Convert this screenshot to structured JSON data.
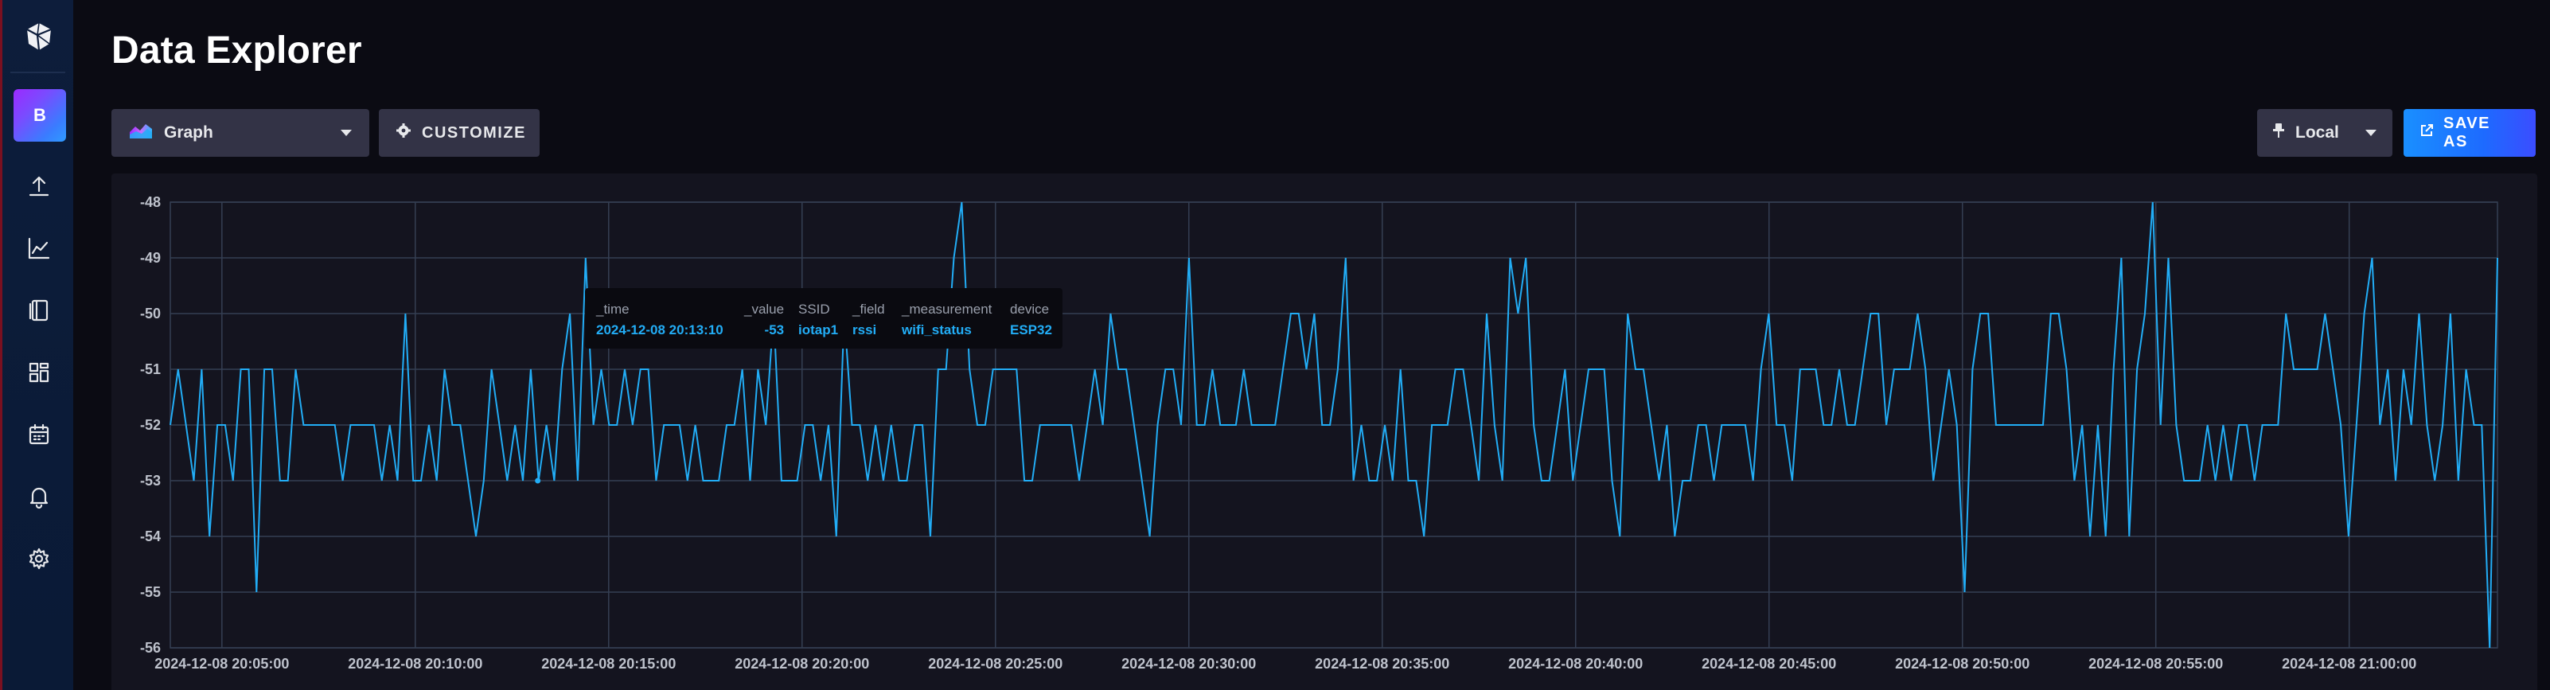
{
  "nav": {
    "logo_icon": "influxdb-cube-icon",
    "org_initial": "B",
    "items": [
      {
        "name": "upload-icon"
      },
      {
        "name": "data-explorer-graph-icon"
      },
      {
        "name": "notebooks-icon"
      },
      {
        "name": "dashboards-icon"
      },
      {
        "name": "tasks-calendar-icon"
      },
      {
        "name": "alerts-bell-icon"
      },
      {
        "name": "settings-gear-icon"
      }
    ]
  },
  "header": {
    "title": "Data Explorer"
  },
  "toolbar": {
    "viz_type_label": "Graph",
    "customize_label": "CUSTOMIZE",
    "timezone_label": "Local",
    "save_as_label": "SAVE AS"
  },
  "colors": {
    "accent": "#22adf6",
    "line": "#22adf6",
    "background": "#0b0b13",
    "panel": "#14141f",
    "grid": "#353f53",
    "save_gradient": [
      "#1a8fff",
      "#3b4dff"
    ]
  },
  "tooltip": {
    "columns": [
      {
        "header": "_time",
        "value": "2024-12-08 20:13:10"
      },
      {
        "header": "_value",
        "value": "-53"
      },
      {
        "header": "SSID",
        "value": "iotap1"
      },
      {
        "header": "_field",
        "value": "rssi"
      },
      {
        "header": "_measurement",
        "value": "wifi_status"
      },
      {
        "header": "device",
        "value": "ESP32"
      }
    ]
  },
  "chart_data": {
    "type": "line",
    "title": "",
    "xlabel": "",
    "ylabel": "",
    "ylim": [
      -56,
      -48
    ],
    "y_ticks": [
      "-48",
      "-49",
      "-50",
      "-51",
      "-52",
      "-53",
      "-54",
      "-55",
      "-56"
    ],
    "x_ticks": [
      "2024-12-08 20:05:00",
      "2024-12-08 20:10:00",
      "2024-12-08 20:15:00",
      "2024-12-08 20:20:00",
      "2024-12-08 20:25:00",
      "2024-12-08 20:30:00",
      "2024-12-08 20:35:00",
      "2024-12-08 20:40:00",
      "2024-12-08 20:45:00",
      "2024-12-08 20:50:00",
      "2024-12-08 20:55:00",
      "2024-12-08 21:00:00"
    ],
    "x_start": "2024-12-08 20:03:40",
    "x_end": "2024-12-08 21:03:50",
    "grid": true,
    "legend": "none",
    "hover_point": {
      "x": "2024-12-08 20:13:10",
      "y": -53
    },
    "series": [
      {
        "values": [
          -52,
          -51,
          -52,
          -53,
          -51,
          -54,
          -52,
          -52,
          -53,
          -51,
          -51,
          -55,
          -51,
          -51,
          -53,
          -53,
          -51,
          -52,
          -52,
          -52,
          -52,
          -52,
          -53,
          -52,
          -52,
          -52,
          -52,
          -53,
          -52,
          -53,
          -50,
          -53,
          -53,
          -52,
          -53,
          -51,
          -52,
          -52,
          -53,
          -54,
          -53,
          -51,
          -52,
          -53,
          -52,
          -53,
          -51,
          -53,
          -52,
          -53,
          -51,
          -50,
          -53,
          -49,
          -52,
          -51,
          -52,
          -52,
          -51,
          -52,
          -51,
          -51,
          -53,
          -52,
          -52,
          -52,
          -53,
          -52,
          -53,
          -53,
          -53,
          -52,
          -52,
          -51,
          -53,
          -51,
          -52,
          -50,
          -53,
          -53,
          -53,
          -52,
          -52,
          -53,
          -52,
          -54,
          -50,
          -52,
          -52,
          -53,
          -52,
          -53,
          -52,
          -53,
          -53,
          -52,
          -52,
          -54,
          -51,
          -51,
          -49,
          -48,
          -51,
          -52,
          -52,
          -51,
          -51,
          -51,
          -51,
          -53,
          -53,
          -52,
          -52,
          -52,
          -52,
          -52,
          -53,
          -52,
          -51,
          -52,
          -50,
          -51,
          -51,
          -52,
          -53,
          -54,
          -52,
          -51,
          -51,
          -52,
          -49,
          -52,
          -52,
          -51,
          -52,
          -52,
          -52,
          -51,
          -52,
          -52,
          -52,
          -52,
          -51,
          -50,
          -50,
          -51,
          -50,
          -52,
          -52,
          -51,
          -49,
          -53,
          -52,
          -53,
          -53,
          -52,
          -53,
          -51,
          -53,
          -53,
          -54,
          -52,
          -52,
          -52,
          -51,
          -51,
          -52,
          -53,
          -50,
          -52,
          -53,
          -49,
          -50,
          -49,
          -52,
          -53,
          -53,
          -52,
          -51,
          -53,
          -52,
          -51,
          -51,
          -51,
          -53,
          -54,
          -50,
          -51,
          -51,
          -52,
          -53,
          -52,
          -54,
          -53,
          -53,
          -52,
          -52,
          -53,
          -52,
          -52,
          -52,
          -52,
          -53,
          -51,
          -50,
          -52,
          -52,
          -53,
          -51,
          -51,
          -51,
          -52,
          -52,
          -51,
          -52,
          -52,
          -51,
          -50,
          -50,
          -52,
          -51,
          -51,
          -51,
          -50,
          -51,
          -53,
          -52,
          -51,
          -52,
          -55,
          -51,
          -50,
          -50,
          -52,
          -52,
          -52,
          -52,
          -52,
          -52,
          -52,
          -50,
          -50,
          -51,
          -53,
          -52,
          -54,
          -52,
          -54,
          -51,
          -49,
          -54,
          -51,
          -50,
          -48,
          -52,
          -49,
          -52,
          -53,
          -53,
          -53,
          -52,
          -53,
          -52,
          -53,
          -52,
          -52,
          -53,
          -52,
          -52,
          -52,
          -50,
          -51,
          -51,
          -51,
          -51,
          -50,
          -51,
          -52,
          -54,
          -52,
          -50,
          -49,
          -52,
          -51,
          -53,
          -51,
          -52,
          -50,
          -52,
          -53,
          -52,
          -50,
          -53,
          -51,
          -52,
          -52,
          -56,
          -49
        ]
      }
    ]
  }
}
